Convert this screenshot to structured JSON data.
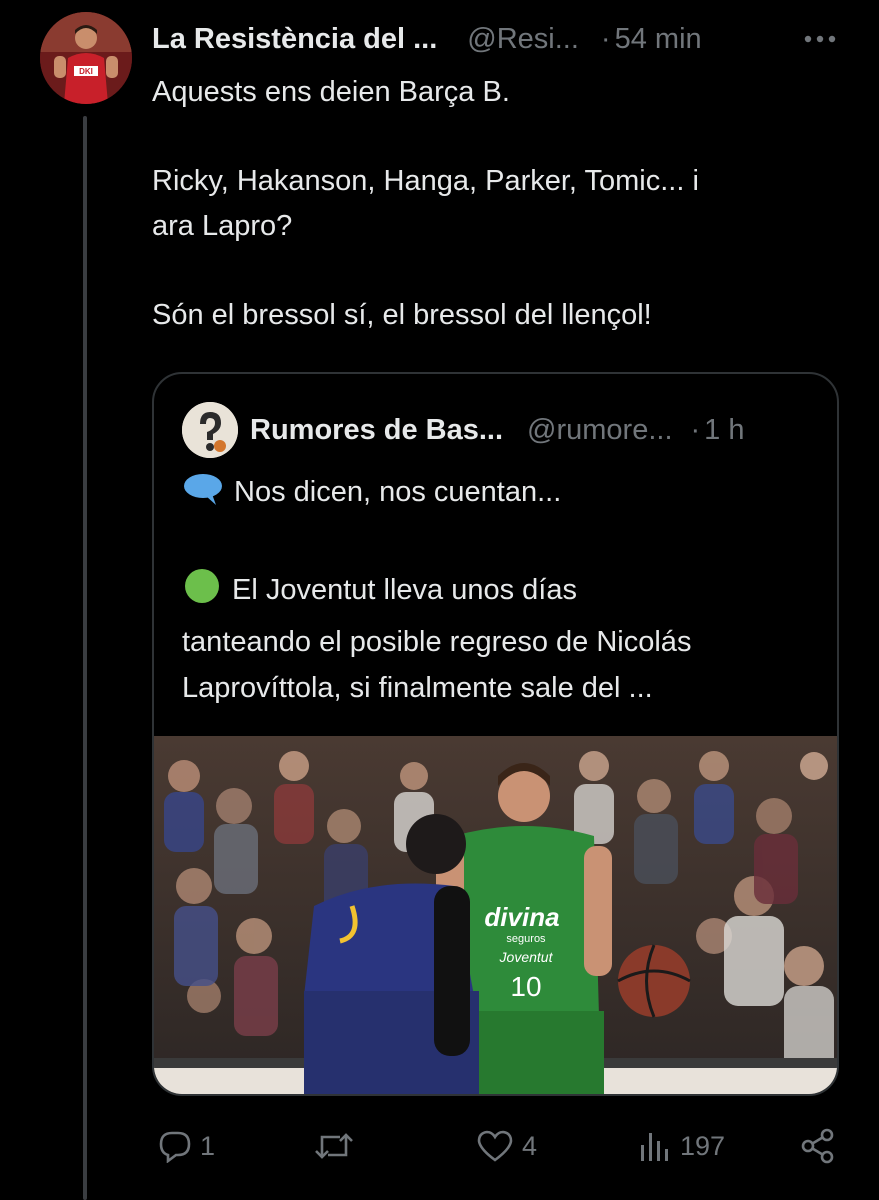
{
  "tweet": {
    "author_name": "La Resistència del ...",
    "author_handle": "@Resi...",
    "separator": "·",
    "time": "54 min",
    "more_icon": "more-dots-icon",
    "paragraphs": [
      "Aquests ens deien Barça B.",
      "",
      "Ricky, Hakanson, Hanga, Parker, Tomic... i",
      "ara Lapro?",
      "",
      "Són el bressol sí, el bressol del llençol!"
    ]
  },
  "quote": {
    "author_name": "Rumores de Bas...",
    "author_handle": "@rumore...",
    "separator": "·",
    "time": "1 h",
    "line1_emoji": "speech-bubble-icon",
    "line1": "Nos dicen, nos cuentan...",
    "line2_emoji": "green-circle-icon",
    "line2": "El Joventut lleva unos días",
    "line3": "tanteando el posible regreso de Nicolás",
    "line4": "Laprovíttola, si finalmente sale del ...",
    "image_print": {
      "sponsor": "divina",
      "sponsor_sub": "seguros",
      "team": "Joventut",
      "number": "10"
    }
  },
  "actions": {
    "reply_count": "1",
    "retweet_count": "",
    "like_count": "4",
    "views_count": "197",
    "icons": [
      "reply-icon",
      "retweet-icon",
      "like-icon",
      "views-icon",
      "share-icon"
    ]
  },
  "colors": {
    "background": "#000000",
    "text": "#e7e9ea",
    "muted": "#71767b",
    "border": "#2f3336",
    "joventut_green": "#2e8b3a",
    "barca_blue": "#2a3580"
  }
}
